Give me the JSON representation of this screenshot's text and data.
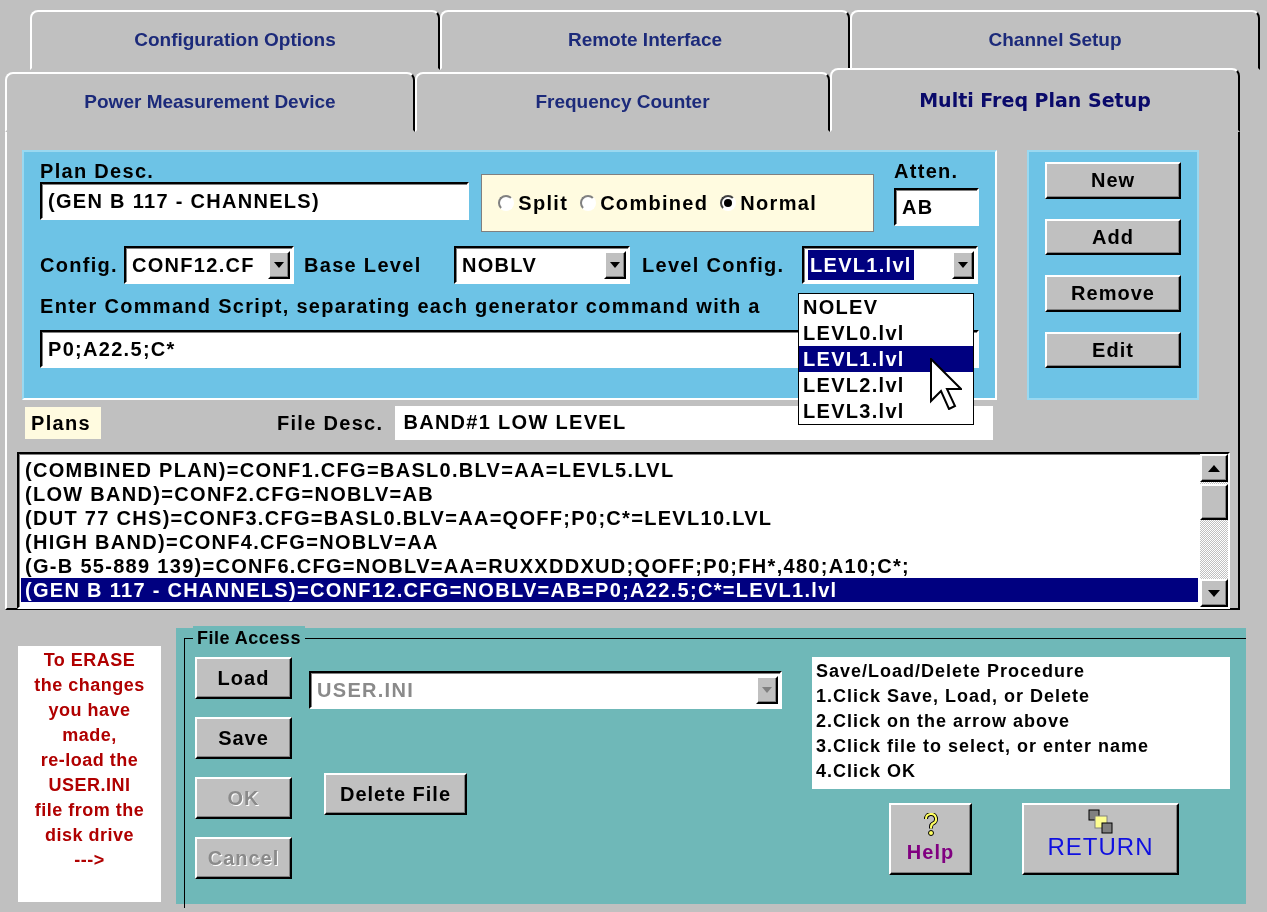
{
  "tab_rows": [
    {
      "tabs": [
        {
          "label": "Configuration Options",
          "selected": false
        },
        {
          "label": "Remote Interface",
          "selected": false
        },
        {
          "label": "Channel Setup",
          "selected": false
        }
      ]
    },
    {
      "tabs": [
        {
          "label": "Power Measurement Device",
          "selected": false
        },
        {
          "label": "Frequency Counter",
          "selected": false
        },
        {
          "label": "Multi Freq Plan Setup",
          "selected": true
        }
      ]
    }
  ],
  "plan_editor": {
    "plan_desc_label": "Plan Desc.",
    "plan_desc": "(GEN B 117 - CHANNELS)",
    "mode_options": [
      {
        "label": "Split",
        "selected": false
      },
      {
        "label": "Combined",
        "selected": false
      },
      {
        "label": "Normal",
        "selected": true
      }
    ],
    "atten_label": "Atten.",
    "atten": "AB",
    "config_label": "Config.",
    "config": "CONF12.CF",
    "base_level_label": "Base Level",
    "base_level": "NOBLV",
    "level_config_label": "Level Config.",
    "level_config": "LEVL1.lvl",
    "level_config_dropdown": {
      "expanded": true,
      "options": [
        {
          "label": "NOLEV",
          "selected": false
        },
        {
          "label": "LEVL0.lvl",
          "selected": false
        },
        {
          "label": "LEVL1.lvl",
          "selected": true
        },
        {
          "label": "LEVL2.lvl",
          "selected": false
        },
        {
          "label": "LEVL3.lvl",
          "selected": false
        }
      ]
    },
    "script_prompt": "Enter Command Script, separating each generator command with a",
    "command_script": "P0;A22.5;C*"
  },
  "plan_buttons": [
    "New",
    "Add",
    "Remove",
    "Edit"
  ],
  "plans_label": "Plans",
  "file_desc_label": "File Desc.",
  "file_desc": "BAND#1 LOW LEVEL",
  "plans_list": [
    {
      "text": "(COMBINED PLAN)=CONF1.CFG=BASL0.BLV=AA=LEVL5.LVL",
      "selected": false
    },
    {
      "text": "(LOW BAND)=CONF2.CFG=NOBLV=AB",
      "selected": false
    },
    {
      "text": "(DUT 77 CHS)=CONF3.CFG=BASL0.BLV=AA=QOFF;P0;C*=LEVL10.LVL",
      "selected": false
    },
    {
      "text": "(HIGH BAND)=CONF4.CFG=NOBLV=AA",
      "selected": false
    },
    {
      "text": "(G-B 55-889 139)=CONF6.CFG=NOBLV=AA=RUXXDDXUD;QOFF;P0;FH*,480;A10;C*;",
      "selected": false
    },
    {
      "text": "(GEN B 117 - CHANNELS)=CONF12.CFG=NOBLV=AB=P0;A22.5;C*=LEVL1.lvl",
      "selected": true
    }
  ],
  "erase_note_lines": [
    "To ERASE",
    "the changes",
    "you have",
    "made,",
    "re-load the",
    "USER.INI",
    "file from the",
    "disk drive",
    "--->"
  ],
  "file_access": {
    "title": "File Access",
    "buttons": [
      {
        "label": "Load",
        "disabled": false
      },
      {
        "label": "Save",
        "disabled": false
      },
      {
        "label": "OK",
        "disabled": true
      },
      {
        "label": "Cancel",
        "disabled": true
      }
    ],
    "file": "USER.INI",
    "file_disabled": true,
    "delete_button": "Delete File",
    "procedure_lines": [
      "Save/Load/Delete Procedure",
      "1.Click Save, Load, or Delete",
      "2.Click on the arrow above",
      "3.Click file to select, or enter name",
      "4.Click OK"
    ],
    "help_button": "Help",
    "return_button": "RETURN"
  }
}
